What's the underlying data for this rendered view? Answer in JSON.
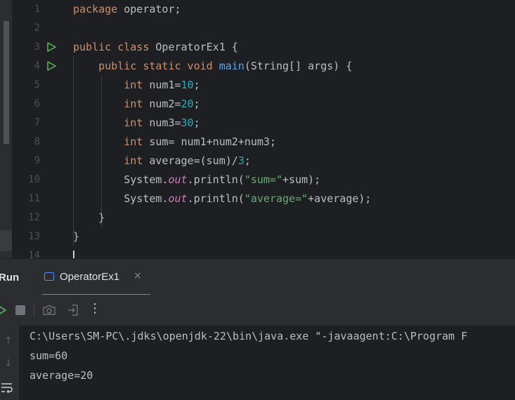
{
  "editor": {
    "line_numbers": [
      "1",
      "2",
      "3",
      "4",
      "5",
      "6",
      "7",
      "8",
      "9",
      "10",
      "11",
      "12",
      "13",
      "14"
    ],
    "lines": [
      [
        {
          "t": "package",
          "c": "kw"
        },
        {
          "t": " operator;",
          "c": ""
        }
      ],
      [],
      [
        {
          "t": "public class",
          "c": "kw"
        },
        {
          "t": " OperatorEx1 {",
          "c": ""
        }
      ],
      [
        {
          "t": "    ",
          "c": ""
        },
        {
          "t": "public static void",
          "c": "kw"
        },
        {
          "t": " ",
          "c": ""
        },
        {
          "t": "main",
          "c": "fn"
        },
        {
          "t": "(String[] args) {",
          "c": ""
        }
      ],
      [
        {
          "t": "        ",
          "c": ""
        },
        {
          "t": "int",
          "c": "kw"
        },
        {
          "t": " num1=",
          "c": ""
        },
        {
          "t": "10",
          "c": "num"
        },
        {
          "t": ";",
          "c": ""
        }
      ],
      [
        {
          "t": "        ",
          "c": ""
        },
        {
          "t": "int",
          "c": "kw"
        },
        {
          "t": " num2=",
          "c": ""
        },
        {
          "t": "20",
          "c": "num"
        },
        {
          "t": ";",
          "c": ""
        }
      ],
      [
        {
          "t": "        ",
          "c": ""
        },
        {
          "t": "int",
          "c": "kw"
        },
        {
          "t": " num3=",
          "c": ""
        },
        {
          "t": "30",
          "c": "num"
        },
        {
          "t": ";",
          "c": ""
        }
      ],
      [
        {
          "t": "        ",
          "c": ""
        },
        {
          "t": "int",
          "c": "kw"
        },
        {
          "t": " sum= num1+num2+num3;",
          "c": ""
        }
      ],
      [
        {
          "t": "        ",
          "c": ""
        },
        {
          "t": "int",
          "c": "kw"
        },
        {
          "t": " average=(sum)/",
          "c": ""
        },
        {
          "t": "3",
          "c": "num"
        },
        {
          "t": ";",
          "c": ""
        }
      ],
      [
        {
          "t": "        System.",
          "c": ""
        },
        {
          "t": "out",
          "c": "fld"
        },
        {
          "t": ".println(",
          "c": ""
        },
        {
          "t": "\"sum=\"",
          "c": "str"
        },
        {
          "t": "+sum);",
          "c": ""
        }
      ],
      [
        {
          "t": "        System.",
          "c": ""
        },
        {
          "t": "out",
          "c": "fld"
        },
        {
          "t": ".println(",
          "c": ""
        },
        {
          "t": "\"average=\"",
          "c": "str"
        },
        {
          "t": "+average);",
          "c": ""
        }
      ],
      [
        {
          "t": "    }",
          "c": ""
        }
      ],
      [
        {
          "t": "}",
          "c": ""
        }
      ]
    ],
    "run_gutter_lines": [
      3,
      4
    ]
  },
  "run_panel": {
    "title": "Run",
    "tab_label": "OperatorEx1",
    "tab_close": "×",
    "toolbar_more": "⋮",
    "side_up": "↑",
    "side_down": "↓",
    "console_lines": [
      "C:\\Users\\SM-PC\\.jdks\\openjdk-22\\bin\\java.exe \"-javaagent:C:\\Program F",
      "sum=60",
      "average=20"
    ]
  },
  "colors": {
    "keyword": "#cf8e6d",
    "number": "#2aacb8",
    "method": "#56a8f5",
    "string": "#6aab73",
    "static_field": "#c77dbb",
    "run_icon": "#5fb85c",
    "accent": "#548af7"
  },
  "icons": [
    "run-gutter-icon",
    "rerun-icon",
    "stop-icon",
    "camera-icon",
    "login-icon",
    "more-vertical-icon",
    "scroll-up-icon",
    "scroll-down-icon",
    "soft-wrap-icon",
    "close-icon",
    "run-config-icon"
  ]
}
